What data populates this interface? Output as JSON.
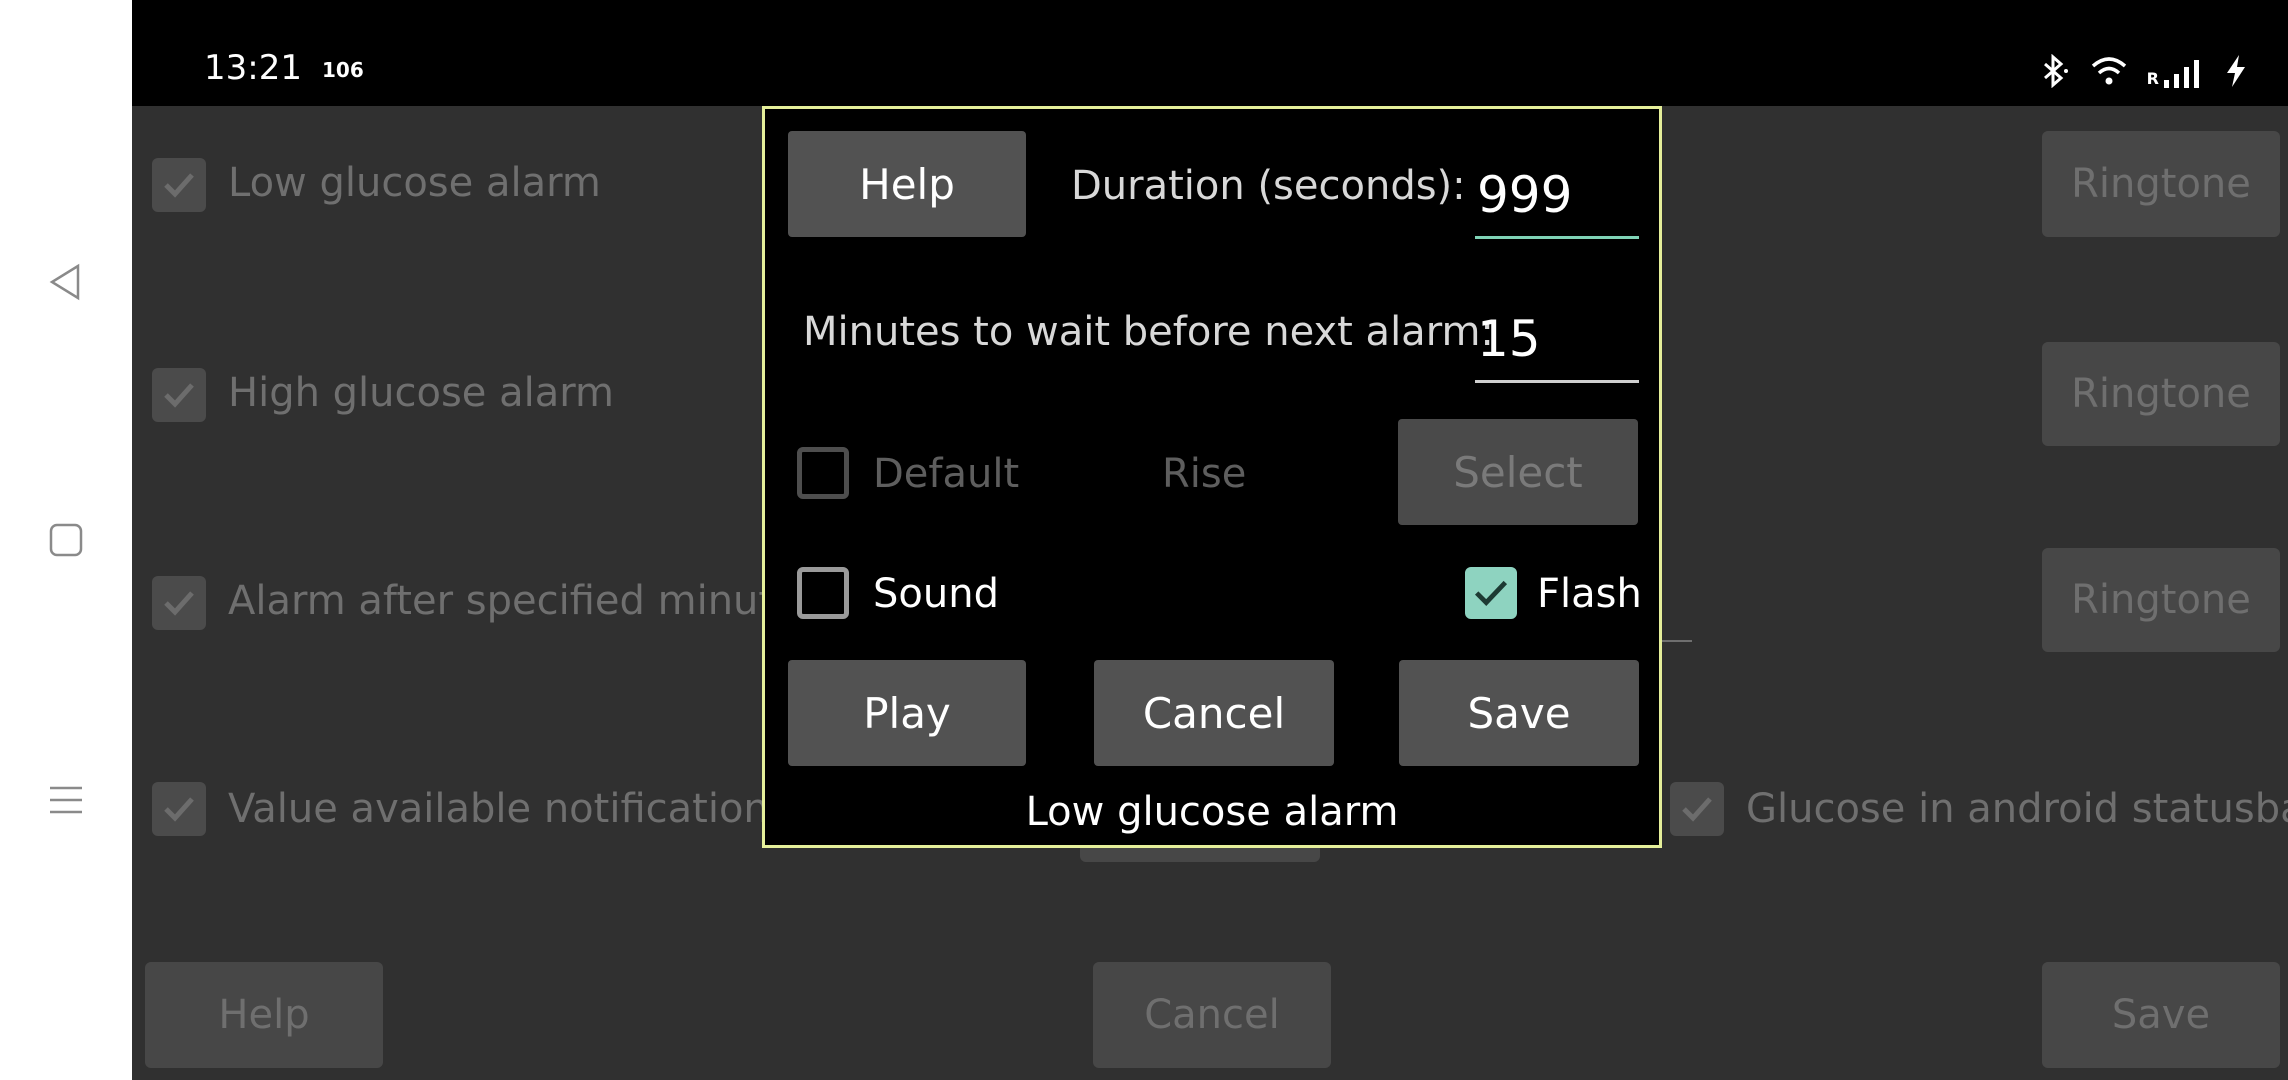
{
  "statusbar": {
    "time": "13:21",
    "indicator": "106",
    "icons": [
      "bluetooth-icon",
      "wifi-icon",
      "signal-icon",
      "charging-icon"
    ],
    "signal_label": "R"
  },
  "navbar": {
    "icons": [
      "back-icon",
      "home-icon",
      "menu-icon"
    ]
  },
  "background": {
    "rows": [
      {
        "label": "Low glucose alarm",
        "checked": true,
        "button": "Ringtone"
      },
      {
        "label": "High glucose alarm",
        "checked": true,
        "button": "Ringtone"
      },
      {
        "label": "Alarm after specified minute",
        "checked": true,
        "button": "Ringtone"
      },
      {
        "label": "Value available notification",
        "checked": true,
        "button": null
      }
    ],
    "statusbar_option": {
      "label": "Glucose in android statusbar",
      "checked": true
    },
    "footer": {
      "help": "Help",
      "cancel": "Cancel",
      "save": "Save"
    }
  },
  "dialog": {
    "help_label": "Help",
    "duration_label": "Duration (seconds):",
    "duration_value": "999",
    "wait_label": "Minutes to wait before next alarm:",
    "wait_value": "15",
    "default_label": "Default",
    "default_checked": false,
    "ringtone_name": "Rise",
    "select_label": "Select",
    "sound_label": "Sound",
    "sound_checked": false,
    "flash_label": "Flash",
    "flash_checked": true,
    "play_label": "Play",
    "cancel_label": "Cancel",
    "save_label": "Save",
    "title": "Low glucose alarm",
    "accent_color": "#8ed3c0",
    "border_color": "#e5ef9a"
  }
}
